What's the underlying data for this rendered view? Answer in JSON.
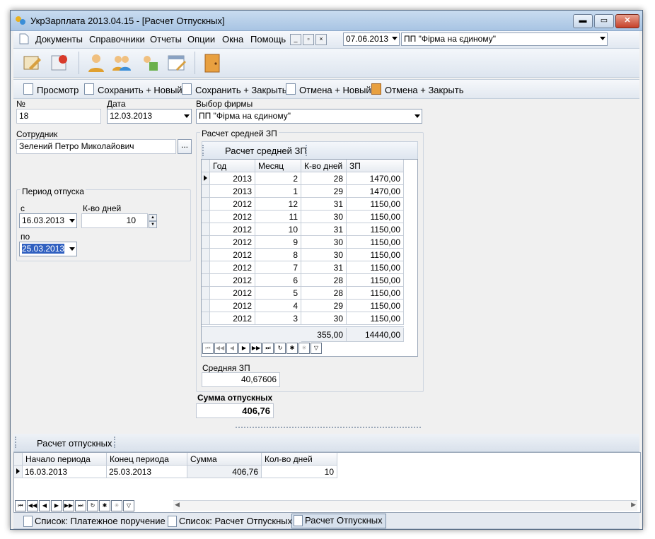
{
  "window": {
    "title": "УкрЗарплата 2013.04.15 - [Расчет Отпускных]"
  },
  "menu": {
    "items": [
      "Документы",
      "Справочники",
      "Отчеты",
      "Опции",
      "Окна",
      "Помощь"
    ],
    "date_value": "07.06.2013",
    "company_value": "ПП \"Фірма на єдиному\""
  },
  "toolbar": {
    "icons": [
      "document-edit-icon",
      "delete-icon",
      "user-icon",
      "users-icon",
      "calc-icon",
      "calendar-icon",
      "exit-icon"
    ]
  },
  "actions": {
    "preview": "Просмотр",
    "save_new": "Сохранить + Новый",
    "save_close": "Сохранить + Закрыть",
    "cancel_new": "Отмена + Новый",
    "cancel_close": "Отмена + Закрыть"
  },
  "form": {
    "number_label": "№",
    "number_value": "18",
    "date_label": "Дата",
    "date_value": "12.03.2013",
    "company_label": "Выбор фирмы",
    "company_value": "ПП \"Фірма на єдиному\"",
    "employee_label": "Сотрудник",
    "employee_value": "Зелений Петро Миколайович",
    "browse_label": "...",
    "vacation_group": "Период отпуска",
    "from_label": "с",
    "from_value": "16.03.2013",
    "days_label": "К-во дней",
    "days_value": "10",
    "to_label": "по",
    "to_value": "25.03.2013"
  },
  "avg": {
    "group_label": "Расчет средней ЗП",
    "tab_label": "Расчет средней ЗП",
    "headers": [
      "Год",
      "Месяц",
      "К-во дней",
      "ЗП"
    ],
    "rows": [
      [
        "2013",
        "2",
        "28",
        "1470,00"
      ],
      [
        "2013",
        "1",
        "29",
        "1470,00"
      ],
      [
        "2012",
        "12",
        "31",
        "1150,00"
      ],
      [
        "2012",
        "11",
        "30",
        "1150,00"
      ],
      [
        "2012",
        "10",
        "31",
        "1150,00"
      ],
      [
        "2012",
        "9",
        "30",
        "1150,00"
      ],
      [
        "2012",
        "8",
        "30",
        "1150,00"
      ],
      [
        "2012",
        "7",
        "31",
        "1150,00"
      ],
      [
        "2012",
        "6",
        "28",
        "1150,00"
      ],
      [
        "2012",
        "5",
        "28",
        "1150,00"
      ],
      [
        "2012",
        "4",
        "29",
        "1150,00"
      ],
      [
        "2012",
        "3",
        "30",
        "1150,00"
      ]
    ],
    "total_days": "355,00",
    "total_sum": "14440,00",
    "avg_label": "Средняя ЗП",
    "avg_value": "40,67606"
  },
  "total": {
    "label": "Сумма отпускных",
    "value": "406,76"
  },
  "bottom": {
    "tab_label": "Расчет отпускных",
    "headers": [
      "Начало периода",
      "Конец периода",
      "Сумма",
      "Кол-во дней"
    ],
    "row": [
      "16.03.2013",
      "25.03.2013",
      "406,76",
      "10"
    ]
  },
  "doc_tabs": [
    "Список: Платежное поручение",
    "Список: Расчет Отпускных",
    "Расчет Отпускных"
  ]
}
